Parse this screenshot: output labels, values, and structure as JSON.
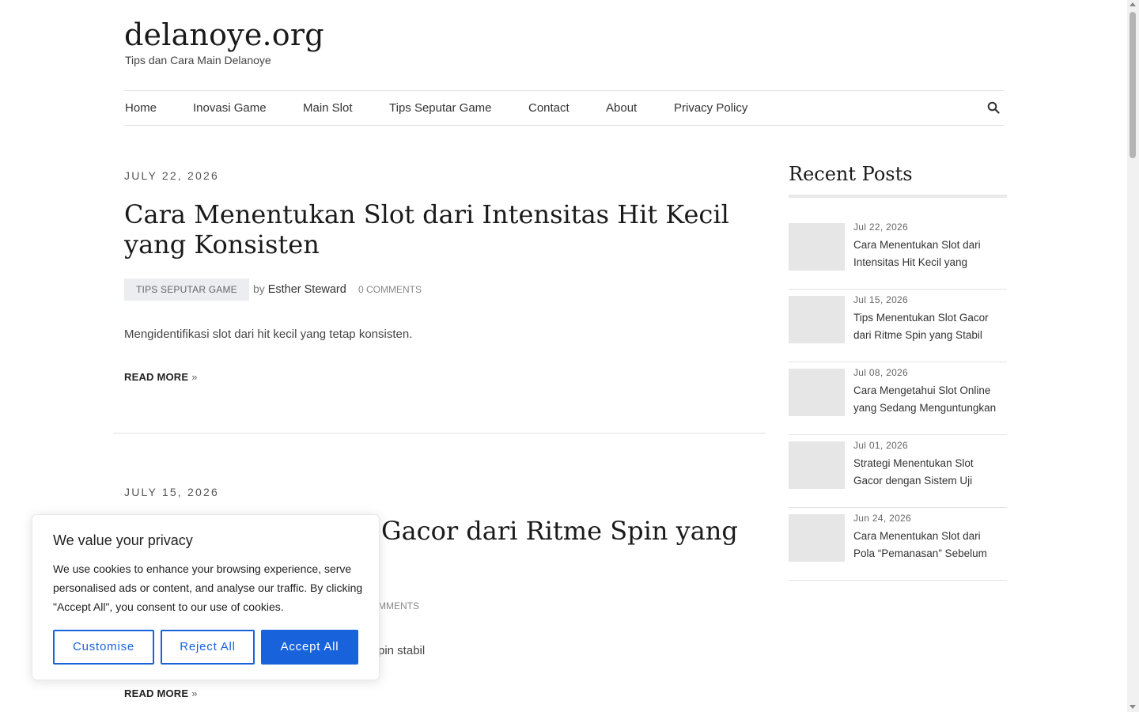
{
  "site": {
    "title": "delanoye.org",
    "tagline": "Tips dan Cara Main Delanoye"
  },
  "nav": {
    "items": [
      "Home",
      "Inovasi Game",
      "Main Slot",
      "Tips Seputar Game",
      "Contact",
      "About",
      "Privacy Policy"
    ],
    "search_icon": "search-icon"
  },
  "posts": [
    {
      "date": "JULY 22, 2026",
      "title": "Cara Menentukan Slot dari Intensitas Hit Kecil yang Konsisten",
      "category": "TIPS SEPUTAR GAME",
      "by": "by",
      "author": "Esther Steward",
      "comments": "0 COMMENTS",
      "excerpt": "Mengidentifikasi slot dari hit kecil yang tetap konsisten.",
      "read_more": "READ MORE"
    },
    {
      "date": "JULY 15, 2026",
      "title_visible": "Gacor dari Ritme Spin yang",
      "comments_visible": "MMENTS",
      "excerpt_visible": "pin stabil",
      "read_more": "READ MORE"
    }
  ],
  "sidebar": {
    "title": "Recent Posts",
    "recent_posts": [
      {
        "date": "Jul 22, 2026",
        "title": "Cara Menentukan Slot dari Intensitas Hit Kecil yang"
      },
      {
        "date": "Jul 15, 2026",
        "title": "Tips Menentukan Slot Gacor dari Ritme Spin yang Stabil"
      },
      {
        "date": "Jul 08, 2026",
        "title": "Cara Mengetahui Slot Online yang Sedang Menguntungkan"
      },
      {
        "date": "Jul 01, 2026",
        "title": "Strategi Menentukan Slot Gacor dengan Sistem Uji"
      },
      {
        "date": "Jun 24, 2026",
        "title": "Cara Menentukan Slot dari Pola “Pemanasan” Sebelum"
      }
    ]
  },
  "cookie": {
    "title": "We value your privacy",
    "text": "We use cookies to enhance your browsing experience, serve personalised ads or content, and analyse our traffic. By clicking \"Accept All\", you consent to our use of cookies.",
    "customise": "Customise",
    "reject": "Reject All",
    "accept": "Accept All"
  },
  "colors": {
    "accent": "#1863dc",
    "badge_bg": "#ebedf0",
    "thumb_bg": "#e6e6e6"
  }
}
